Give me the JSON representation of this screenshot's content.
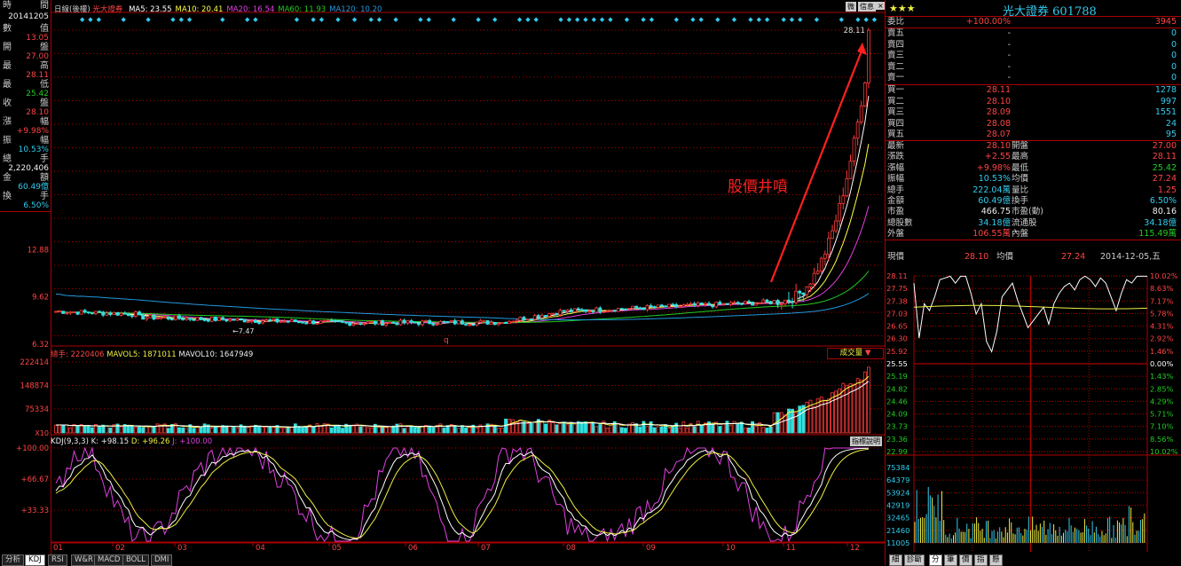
{
  "colors": {
    "up": "#ff3b3b",
    "down": "#33e0e0",
    "ma5": "#ffffff",
    "ma10": "#ffff44",
    "ma20": "#e040e0",
    "ma60": "#22cc22",
    "ma120": "#2299dd",
    "grid": "#aa0000"
  },
  "left_info": {
    "header_l": "時",
    "header_r": "間",
    "date": "20141205",
    "rows": [
      {
        "l": "數",
        "r": "值",
        "v": "13.05",
        "c": "red"
      },
      {
        "l": "開",
        "r": "盤",
        "v": "27.00",
        "c": "red"
      },
      {
        "l": "最",
        "r": "高",
        "v": "28.11",
        "c": "red"
      },
      {
        "l": "最",
        "r": "低",
        "v": "25.42",
        "c": "grn"
      },
      {
        "l": "收",
        "r": "盤",
        "v": "28.10",
        "c": "red"
      },
      {
        "l": "漲",
        "r": "幅",
        "v": "+9.98%",
        "c": "red"
      },
      {
        "l": "振",
        "r": "幅",
        "v": "10.53%",
        "c": "cyn"
      },
      {
        "l": "總",
        "r": "手",
        "v": "2,220,406",
        "c": "wht"
      },
      {
        "l": "金",
        "r": "額",
        "v": "60.49億",
        "c": "cyn"
      },
      {
        "l": "換",
        "r": "手",
        "v": "6.50%",
        "c": "cyn"
      }
    ]
  },
  "main_chart": {
    "period": "日線(後權)",
    "stock": "光大證券",
    "ma": [
      {
        "k": "MA5",
        "v": "23.55"
      },
      {
        "k": "MA10",
        "v": "20.41"
      },
      {
        "k": "MA20",
        "v": "16.54"
      },
      {
        "k": "MA60",
        "v": "11.93"
      },
      {
        "k": "MA120",
        "v": "10.20"
      }
    ],
    "y_ticks": [
      "12.88",
      "9.62",
      "6.32"
    ],
    "max_label": "28.11",
    "min_label": "7.47",
    "annotation": "股價井噴",
    "q_marker": "q"
  },
  "volume_chart": {
    "label": "總手: 2220406",
    "mavol5": "MAVOL5: 1871011",
    "mavol10": "MAVOL10: 1647949",
    "y_ticks": [
      "222414",
      "148874",
      "75334"
    ],
    "unit": "X10",
    "selector": "成交量"
  },
  "kdj_chart": {
    "label": "KDJ(9,3,3) K: +98.15",
    "d": "D: +96.26",
    "j": "J: +100.00",
    "y_ticks": [
      "+100.00",
      "+66.67",
      "+33.33"
    ],
    "help": "指標說明"
  },
  "x_axis": [
    "01",
    "02",
    "03",
    "04",
    "05",
    "06",
    "07",
    "08",
    "09",
    "10",
    "11",
    "12"
  ],
  "top_icons": [
    "trade-icon",
    "info-icon",
    "close-icon"
  ],
  "top_icon_labels": [
    "微",
    "信息"
  ],
  "right_panel": {
    "stars": "★★★",
    "name": "光大證券",
    "code": "601788",
    "commission": {
      "label": "委比",
      "pct": "+100.00%",
      "vol": "3945"
    },
    "sells": [
      {
        "l": "賣五",
        "p": "-",
        "v": "0"
      },
      {
        "l": "賣四",
        "p": "-",
        "v": "0"
      },
      {
        "l": "賣三",
        "p": "-",
        "v": "0"
      },
      {
        "l": "賣二",
        "p": "-",
        "v": "0"
      },
      {
        "l": "賣一",
        "p": "-",
        "v": "0"
      }
    ],
    "buys": [
      {
        "l": "買一",
        "p": "28.11",
        "v": "1278"
      },
      {
        "l": "買二",
        "p": "28.10",
        "v": "997"
      },
      {
        "l": "買三",
        "p": "28.09",
        "v": "1551"
      },
      {
        "l": "買四",
        "p": "28.08",
        "v": "24"
      },
      {
        "l": "買五",
        "p": "28.07",
        "v": "95"
      }
    ],
    "stats": [
      {
        "l1": "最新",
        "v1": "28.10",
        "c1": "red",
        "l2": "開盤",
        "v2": "27.00",
        "c2": "red"
      },
      {
        "l1": "漲跌",
        "v1": "+2.55",
        "c1": "red",
        "l2": "最高",
        "v2": "28.11",
        "c2": "red"
      },
      {
        "l1": "漲幅",
        "v1": "+9.98%",
        "c1": "red",
        "l2": "最低",
        "v2": "25.42",
        "c2": "grn"
      },
      {
        "l1": "振幅",
        "v1": "10.53%",
        "c1": "cyn",
        "l2": "均價",
        "v2": "27.24",
        "c2": "red"
      },
      {
        "l1": "總手",
        "v1": "222.04萬",
        "c1": "cyn",
        "l2": "量比",
        "v2": "1.25",
        "c2": "red"
      },
      {
        "l1": "金額",
        "v1": "60.49億",
        "c1": "cyn",
        "l2": "換手",
        "v2": "6.50%",
        "c2": "cyn"
      },
      {
        "l1": "市盈",
        "v1": "466.75",
        "c1": "wht",
        "l2": "市盈(動)",
        "v2": "80.16",
        "c2": "wht"
      },
      {
        "l1": "總股數",
        "v1": "34.18億",
        "c1": "cyn",
        "l2": "流通股",
        "v2": "34.18億",
        "c2": "cyn"
      },
      {
        "l1": "外盤",
        "v1": "106.55萬",
        "c1": "red",
        "l2": "內盤",
        "v2": "115.49萬",
        "c2": "grn"
      }
    ],
    "intraday": {
      "now_label": "現價",
      "now": "28.10",
      "avg_label": "均價",
      "avg": "27.24",
      "date": "2014-12-05,五",
      "y_left": [
        "28.11",
        "27.75",
        "27.38",
        "27.03",
        "26.65",
        "26.30",
        "25.92",
        "25.55",
        "25.19",
        "24.82",
        "24.46",
        "24.09",
        "23.73",
        "23.36",
        "22.99"
      ],
      "y_right": [
        "10.02%",
        "8.63%",
        "7.17%",
        "5.78%",
        "4.31%",
        "2.92%",
        "1.46%",
        "0.00%",
        "1.43%",
        "2.85%",
        "4.29%",
        "5.71%",
        "7.10%",
        "8.56%",
        "10.02%"
      ],
      "vol_ticks": [
        "75384",
        "64379",
        "53924",
        "42919",
        "32465",
        "21460",
        "11005"
      ]
    },
    "tabs": [
      "細",
      "診斷",
      "分",
      "筆",
      "價",
      "指",
      "懸"
    ]
  },
  "bottom_tabs": [
    "分析",
    "KDJ",
    "RSI",
    "W&R",
    "MACD",
    "BOLL",
    "DMI"
  ],
  "chart_data": [
    {
      "type": "line",
      "title": "光大證券 日線",
      "x_categories": [
        "01",
        "02",
        "03",
        "04",
        "05",
        "06",
        "07",
        "08",
        "09",
        "10",
        "11",
        "12"
      ],
      "series": [
        {
          "name": "MA5",
          "last": 23.55
        },
        {
          "name": "MA10",
          "last": 20.41
        },
        {
          "name": "MA20",
          "last": 16.54
        },
        {
          "name": "MA60",
          "last": 11.93
        },
        {
          "name": "MA120",
          "last": 10.2
        }
      ],
      "close_approx": [
        8.6,
        8.4,
        8.0,
        7.8,
        7.9,
        7.7,
        7.8,
        8.9,
        8.6,
        8.7,
        9.5,
        15.0,
        28.1
      ],
      "ylim": [
        6.32,
        28.11
      ]
    },
    {
      "type": "bar",
      "title": "成交量",
      "last": 2220406,
      "ylim": [
        0,
        222414
      ]
    },
    {
      "type": "line",
      "title": "KDJ(9,3,3)",
      "K": 98.15,
      "D": 96.26,
      "J": 100.0,
      "ylim": [
        0,
        100
      ]
    }
  ]
}
